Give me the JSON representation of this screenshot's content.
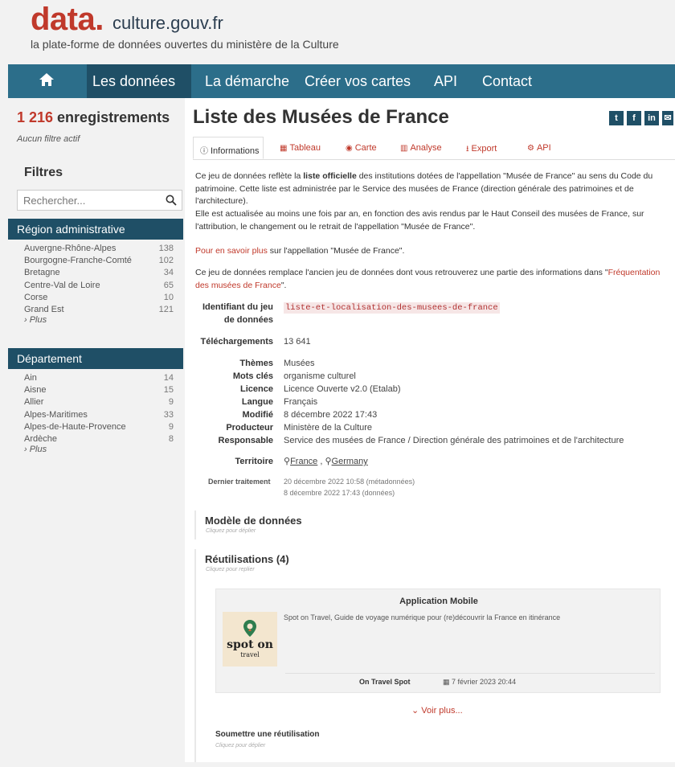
{
  "brand": {
    "main": "data.",
    "rest": "culture.gouv.fr",
    "tagline": "la plate-forme de données ouvertes du ministère de la Culture"
  },
  "nav": {
    "items": [
      "Les données",
      "La démarche",
      "Créer vos cartes",
      "API",
      "Contact"
    ],
    "active": "Les données",
    "icon": "home-icon"
  },
  "sidebar": {
    "count_number": "1 216",
    "count_label": " enregistrements",
    "no_filter": "Aucun filtre actif",
    "filters_title": "Filtres",
    "search_placeholder": "Rechercher...",
    "facets": [
      {
        "title": "Région administrative",
        "items": [
          {
            "label": "Auvergne-Rhône-Alpes",
            "count": "138"
          },
          {
            "label": "Bourgogne-Franche-Comté",
            "count": "102"
          },
          {
            "label": "Bretagne",
            "count": "34"
          },
          {
            "label": "Centre-Val de Loire",
            "count": "65"
          },
          {
            "label": "Corse",
            "count": "10"
          },
          {
            "label": "Grand Est",
            "count": "121"
          }
        ],
        "more": "› Plus"
      },
      {
        "title": "Département",
        "items": [
          {
            "label": "Ain",
            "count": "14"
          },
          {
            "label": "Aisne",
            "count": "15"
          },
          {
            "label": "Allier",
            "count": "9"
          },
          {
            "label": "Alpes-Maritimes",
            "count": "33"
          },
          {
            "label": "Alpes-de-Haute-Provence",
            "count": "9"
          },
          {
            "label": "Ardèche",
            "count": "8"
          }
        ],
        "more": "› Plus"
      }
    ]
  },
  "main": {
    "title": "Liste des Musées de France",
    "share": [
      "t",
      "f",
      "in",
      "✉"
    ],
    "tabs": [
      "Informations",
      "Tableau",
      "Carte",
      "Analyse",
      "Export",
      "API"
    ],
    "active_tab": "Informations",
    "desc": {
      "p1_a": "Ce jeu de données reflète la ",
      "p1_b": "liste officielle",
      "p1_c": " des institutions dotées de l'appellation \"Musée de France\" au sens du Code du patrimoine. Cette liste est administrée par le Service des musées de France (direction générale des patrimoines et de l'architecture).",
      "p2": "Elle est actualisée au moins une fois par an, en fonction des avis rendus par le Haut Conseil des musées de France, sur l'attribution, le changement ou le retrait de l'appellation \"Musée de France\".",
      "p3_link": "Pour en savoir plus",
      "p3_rest": " sur l'appellation \"Musée de France\".",
      "p4_a": "Ce jeu de données remplace l'ancien jeu de données dont vous retrouverez une partie des informations dans \"",
      "p4_link": "Fréquentation des musées de France",
      "p4_c": "\"."
    },
    "meta": {
      "id_label_1": "Identifiant du jeu",
      "id_label_2": "de données",
      "id_value": "liste-et-localisation-des-musees-de-france",
      "downloads_label": "Téléchargements",
      "downloads_value": "13 641",
      "rows": [
        {
          "label": "Thèmes",
          "value": "Musées"
        },
        {
          "label": "Mots clés",
          "value": "organisme culturel"
        },
        {
          "label": "Licence",
          "value": "Licence Ouverte v2.0 (Etalab)"
        },
        {
          "label": "Langue",
          "value": "Français"
        },
        {
          "label": "Modifié",
          "value": "8 décembre 2022 17:43"
        },
        {
          "label": "Producteur",
          "value": "Ministère de la Culture"
        },
        {
          "label": "Responsable",
          "value": "Service des musées de France / Direction générale des patrimoines et de l'architecture"
        }
      ],
      "territory_label": "Territoire",
      "territory_values": [
        "France",
        "Germany"
      ],
      "last_label": "Dernier traitement",
      "last_1": "20 décembre 2022 10:58 (métadonnées)",
      "last_2": "8 décembre 2022 17:43 (données)"
    },
    "model_title": "Modèle de données",
    "model_sub": "Cliquez pour déplier",
    "reuse_title": "Réutilisations (4)",
    "reuse_sub": "Cliquez pour replier",
    "card": {
      "title": "Application Mobile",
      "desc": "Spot on Travel, Guide de voyage numérique pour (re)découvrir la France en itinérance",
      "logo_text_1": "spot on",
      "logo_text_2": "travel",
      "author": "On Travel Spot",
      "date": "7 février 2023 20:44"
    },
    "voir_plus": "⌄ Voir plus...",
    "submit_title": "Soumettre une réutilisation",
    "submit_sub": "Cliquez pour déplier"
  },
  "colors": {
    "brand_red": "#c0392b",
    "nav_blue": "#2c6e8a",
    "dark_teal": "#1f4f66"
  }
}
